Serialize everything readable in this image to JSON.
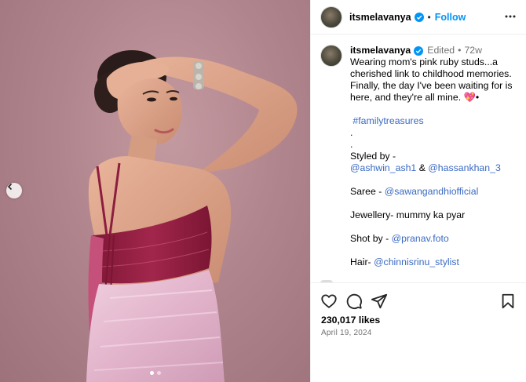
{
  "post": {
    "username": "itsmelavanya",
    "follow_label": "Follow",
    "separator": "•",
    "caption": {
      "username": "itsmelavanya",
      "edited": "Edited",
      "separator": "•",
      "time_ago": "72w",
      "text_main": "Wearing mom's pink ruby studs...a cherished link to childhood memories. Finally, the day I've been waiting for is here, and they're all mine.",
      "emoji": "💖",
      "bullet": "•",
      "hashtag": "#familytreasures",
      "dot1": ".",
      "dot2": ".",
      "styled_by_label": "Styled by -",
      "stylist1": "@ashwin_ash1",
      "amp": "&",
      "stylist2": "@hassankhan_3",
      "saree_label": "Saree -",
      "saree_handle": "@sawangandhiofficial",
      "jewellery_line": "Jewellery- mummy ka pyar",
      "shot_label": "Shot by -",
      "shot_handle": "@pranav.foto",
      "hair_label": "Hair-",
      "hair_handle": "@chinnisrinu_stylist"
    },
    "likes_text": "230,017 likes",
    "date_text": "April 19, 2024",
    "carousel": {
      "slide_count": 2,
      "active_index": 1
    }
  },
  "icons": {
    "verified": "verified-badge-icon",
    "more": "more-options-icon",
    "like": "heart-icon",
    "comment": "comment-icon",
    "share": "share-icon",
    "save": "bookmark-icon",
    "prev": "chevron-left-icon"
  },
  "colors": {
    "link": "#3a6ac3",
    "follow": "#0095f6",
    "verified": "#0095f6",
    "muted": "#737373",
    "backdrop": "#b1858d",
    "blouse": "#9b1f45",
    "saree": "#e4b9cf"
  }
}
